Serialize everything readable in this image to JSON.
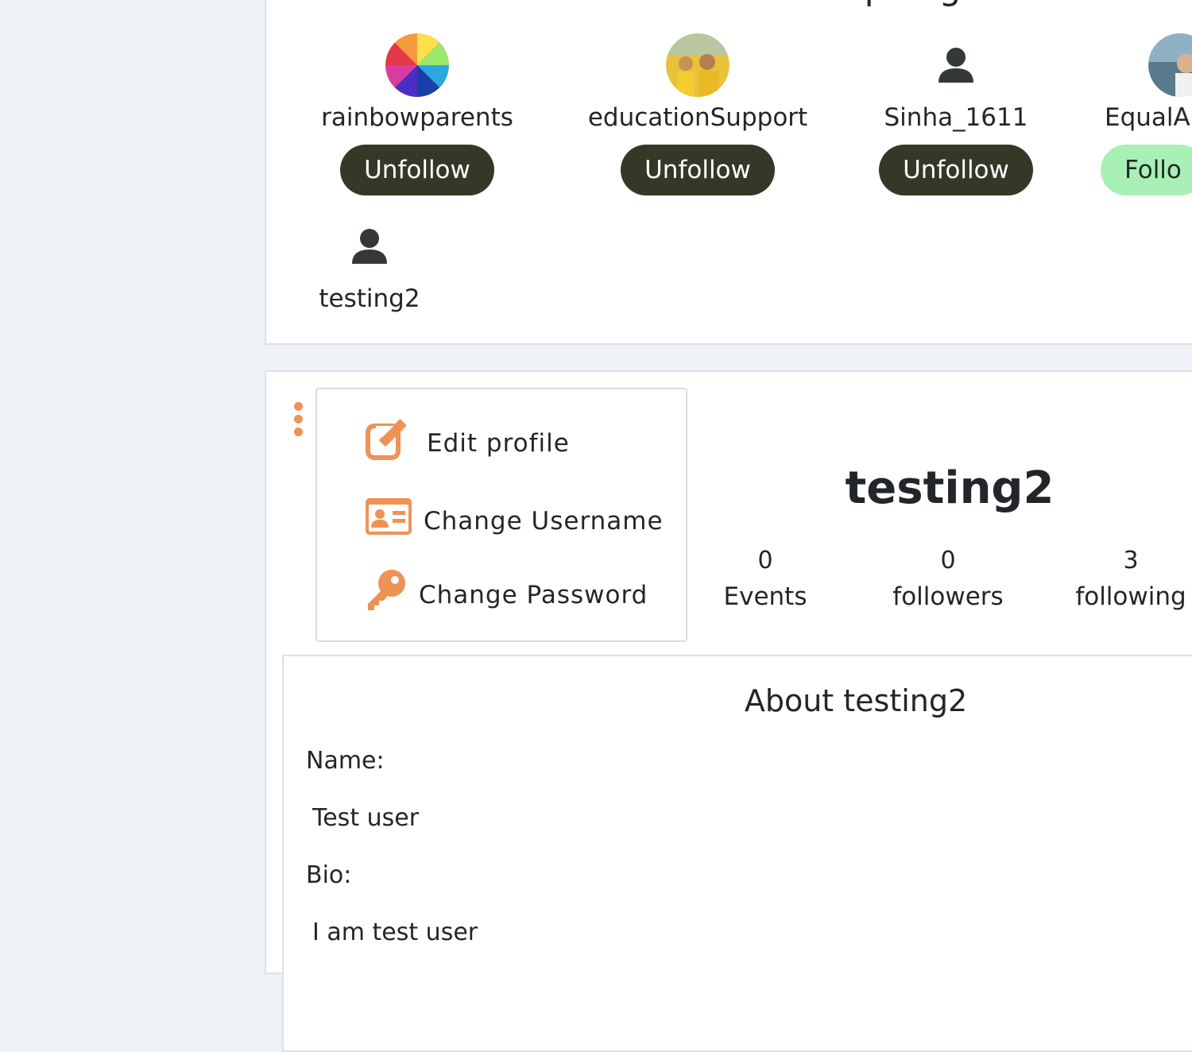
{
  "organisers_section": {
    "title": "Follow our Top Organisers",
    "organisers": [
      {
        "name": "rainbowparents",
        "button": "Unfollow"
      },
      {
        "name": "educationSupport",
        "button": "Unfollow"
      },
      {
        "name": "Sinha_1611",
        "button": "Unfollow"
      },
      {
        "name": "EqualAr",
        "button": "Follo"
      },
      {
        "name": "testing2"
      }
    ]
  },
  "profile": {
    "menu": {
      "edit_profile": "Edit profile",
      "change_username": "Change Username",
      "change_password": "Change Password"
    },
    "username": "testing2",
    "stats": [
      {
        "value": "0",
        "label": "Events"
      },
      {
        "value": "0",
        "label": "followers"
      },
      {
        "value": "3",
        "label": "following"
      }
    ],
    "about": {
      "title": "About testing2",
      "name_label": "Name:",
      "name_value": "Test user",
      "bio_label": "Bio:",
      "bio_value": "I am test user"
    }
  },
  "colors": {
    "accent": "#ef9255",
    "unfollow_bg": "#353826",
    "follow_bg": "#a9f0b7",
    "page_bg": "#eef2f7"
  }
}
